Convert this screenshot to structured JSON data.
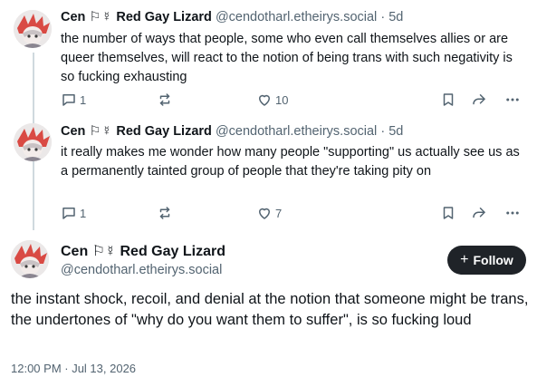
{
  "author": {
    "name": "Cen",
    "flags": "⚐☿",
    "display_suffix": "Red Gay Lizard",
    "handle": "@cendotharl.etheirys.social"
  },
  "posts": [
    {
      "time": "5d",
      "separator": "·",
      "text": "the number of ways that people, some who even call themselves allies or are queer themselves, will react to the notion of being trans with such negativity is so fucking exhausting",
      "reply_count": "1",
      "like_count": "10"
    },
    {
      "time": "5d",
      "separator": "·",
      "text": "it really makes me wonder how many people \"supporting\" us actually see us as a permanently tainted group of people that they're taking pity on",
      "reply_count": "1",
      "like_count": "7"
    }
  ],
  "main_post": {
    "follow_label": "Follow",
    "follow_plus": "+",
    "text": "the instant shock, recoil, and denial at the notion that someone might be trans, the undertones of \"why do you want them to suffer\", is so fucking loud",
    "timestamp": "12:00 PM · Jul 13, 2026"
  },
  "icons": {
    "reply": "reply-icon",
    "repost": "repost-icon",
    "like": "heart-icon",
    "bookmark": "bookmark-icon",
    "share": "share-icon",
    "more": "more-icon"
  },
  "colors": {
    "text": "#0f1419",
    "muted": "#536471",
    "thread_line": "#cfd9de",
    "follow_bg": "#1f2328",
    "avatar_accent": "#d94a44"
  }
}
